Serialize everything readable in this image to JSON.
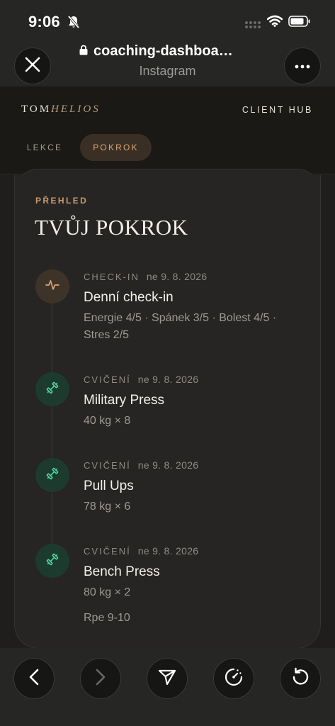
{
  "status_bar": {
    "time": "9:06"
  },
  "browser": {
    "url": "coaching-dashboa…",
    "app_name": "Instagram"
  },
  "site": {
    "brand_first": "TOM",
    "brand_second": "HELIOS",
    "client_hub": "CLIENT HUB",
    "tabs": [
      {
        "label": "LEKCE",
        "active": false
      },
      {
        "label": "POKROK",
        "active": true
      }
    ]
  },
  "card": {
    "section_label": "PŘEHLED",
    "title": "TVŮJ POKROK",
    "entries": [
      {
        "kind": "CHECK-IN",
        "date": "ne 9. 8. 2026",
        "title": "Denní check-in",
        "detail": "Energie 4/5 · Spánek 3/5 · Bolest 4/5 · Stres 2/5",
        "icon": "pulse-icon"
      },
      {
        "kind": "CVIČENÍ",
        "date": "ne 9. 8. 2026",
        "title": "Military Press",
        "detail": "40 kg × 8",
        "icon": "dumbbell-icon"
      },
      {
        "kind": "CVIČENÍ",
        "date": "ne 9. 8. 2026",
        "title": "Pull Ups",
        "detail": "78 kg × 6",
        "icon": "dumbbell-icon"
      },
      {
        "kind": "CVIČENÍ",
        "date": "ne 9. 8. 2026",
        "title": "Bench Press",
        "detail": "80 kg × 2",
        "note": "Rpe 9-10",
        "icon": "dumbbell-icon"
      }
    ]
  },
  "colors": {
    "accent_gold": "#d6a676",
    "exercise_green": "#4fd6a2",
    "background": "#1f1e1c"
  }
}
